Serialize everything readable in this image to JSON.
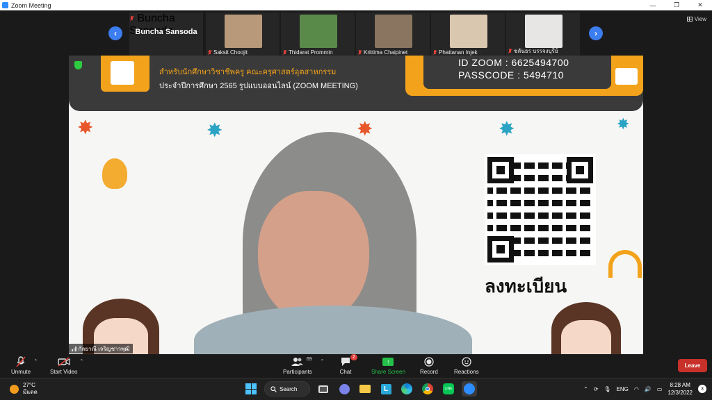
{
  "window": {
    "title": "Zoom Meeting",
    "minimize": "—",
    "restore": "❐",
    "close": "✕"
  },
  "header": {
    "view_label": "View"
  },
  "gallery": {
    "prev_arrow": "‹",
    "next_arrow": "›",
    "host_tile_name": "Buncha Sansoda",
    "participants": [
      {
        "name": "Buncha Sansoda",
        "thumb_color": "#2a2a2a"
      },
      {
        "name": "Saksit Choojit",
        "thumb_color": "#b89a7a"
      },
      {
        "name": "Thidarat Prommin",
        "thumb_color": "#5a8a4a"
      },
      {
        "name": "Krittima Chaipinet",
        "thumb_color": "#8a7560"
      },
      {
        "name": "Phattanan Injek",
        "thumb_color": "#d9c7b0"
      },
      {
        "name": "ชลันธร บรรจงบุรีย์",
        "thumb_color": "#e8e6e4"
      }
    ]
  },
  "banner": {
    "line1": "สำหรับนักศึกษาวิชาชีพครู คณะครุศาสตร์อุตสาหกรรม",
    "line2": "ประจำปีการศึกษา 2565 รูปแบบออนไลน์ (ZOOM MEETING)",
    "id_zoom": "ID ZOOM :    6625494700",
    "passcode": "PASSCODE :   5494710"
  },
  "qr_caption": "ลงทะเบียน",
  "speaker": {
    "name": "กัลยาณี เจริญชาวพุฒิ"
  },
  "controls": {
    "unmute": "Unmute",
    "start_video": "Start Video",
    "participants": "Participants",
    "participants_count": "69",
    "chat": "Chat",
    "chat_badge": "2",
    "share_screen": "Share Screen",
    "record": "Record",
    "reactions": "Reactions",
    "leave": "Leave"
  },
  "taskbar": {
    "temperature": "27°C",
    "weather_text": "มีแดด",
    "search": "Search",
    "language": "ENG",
    "time": "8:28 AM",
    "date": "12/3/2022",
    "notifications": "3"
  },
  "colors": {
    "accent_blue": "#3c7df0",
    "banner_orange": "#f3a31b",
    "leave_red": "#c8302a",
    "share_green": "#24c04a"
  }
}
